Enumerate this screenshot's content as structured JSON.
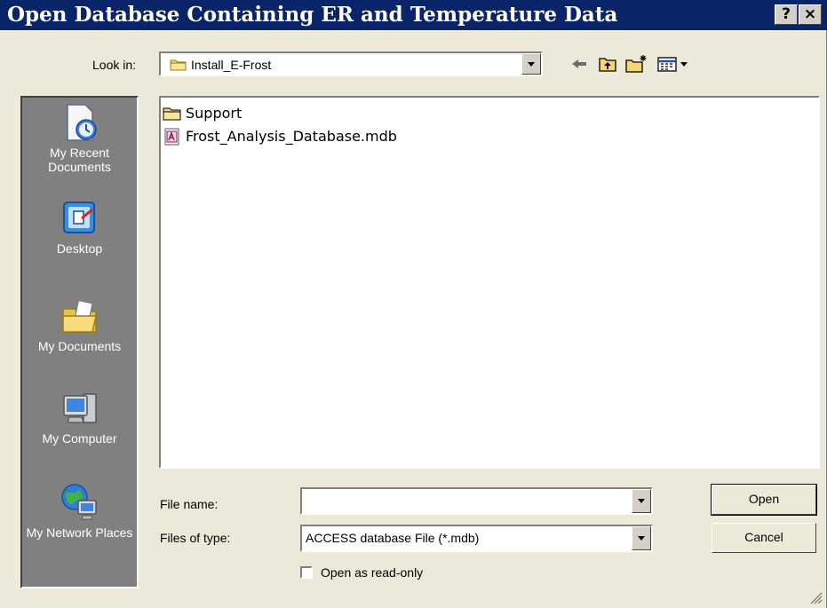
{
  "window": {
    "title": "Open Database Containing ER and Temperature Data",
    "help_label": "?",
    "close_label": "×"
  },
  "lookin": {
    "label": "Look in:",
    "value": "Install_E-Frost"
  },
  "places": [
    {
      "label": "My Recent Documents",
      "icon": "recent-documents-icon"
    },
    {
      "label": "Desktop",
      "icon": "desktop-icon"
    },
    {
      "label": "My Documents",
      "icon": "my-documents-icon"
    },
    {
      "label": "My Computer",
      "icon": "my-computer-icon"
    },
    {
      "label": "My Network Places",
      "icon": "network-places-icon"
    }
  ],
  "files": [
    {
      "name": "Support",
      "type": "folder"
    },
    {
      "name": "Frost_Analysis_Database.mdb",
      "type": "access-database"
    }
  ],
  "file_name": {
    "label": "File name:",
    "value": ""
  },
  "file_type": {
    "label": "Files of type:",
    "value": "ACCESS database File (*.mdb)"
  },
  "readonly": {
    "label": "Open as read-only",
    "checked": false
  },
  "buttons": {
    "open": "Open",
    "cancel": "Cancel"
  },
  "colors": {
    "titlebar": "#0a246a",
    "dialog_bg": "#ece9d8",
    "places_bg": "#808080"
  }
}
